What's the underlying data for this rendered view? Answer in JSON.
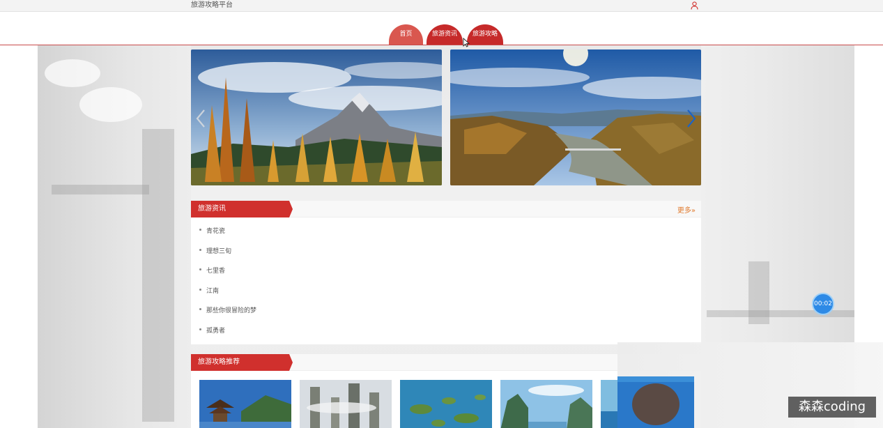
{
  "header": {
    "site_title": "旅游攻略平台",
    "user_icon": "user-icon"
  },
  "nav": {
    "tabs": [
      {
        "label": "首页",
        "active": true
      },
      {
        "label": "旅游资讯",
        "active": false
      },
      {
        "label": "旅游攻略",
        "active": false
      }
    ]
  },
  "carousel": {
    "slides": [
      {
        "scene": "autumn-mountain-lake"
      },
      {
        "scene": "river-valley-forest"
      }
    ],
    "prev_icon": "chevron-left-icon",
    "next_icon": "chevron-right-icon"
  },
  "news": {
    "title": "旅游资讯",
    "more_label": "更多",
    "more_icon": "double-chevron-right-icon",
    "items": [
      "青花瓷",
      "理想三旬",
      "七里香",
      "江南",
      "那些你很冒险的梦",
      "孤勇者"
    ]
  },
  "guides": {
    "title": "旅游攻略推荐",
    "thumbs": [
      {
        "scene": "pagoda-lake"
      },
      {
        "scene": "karst-pillars"
      },
      {
        "scene": "island-lake"
      },
      {
        "scene": "karst-river"
      },
      {
        "scene": "coast"
      }
    ]
  },
  "overlay": {
    "timer": "00:02",
    "watermark": "森森coding"
  },
  "colors": {
    "accent_red": "#d0302d",
    "active_tab": "#d9574f",
    "more_orange": "#e07a2e",
    "timer_blue": "#2e8ae6"
  }
}
